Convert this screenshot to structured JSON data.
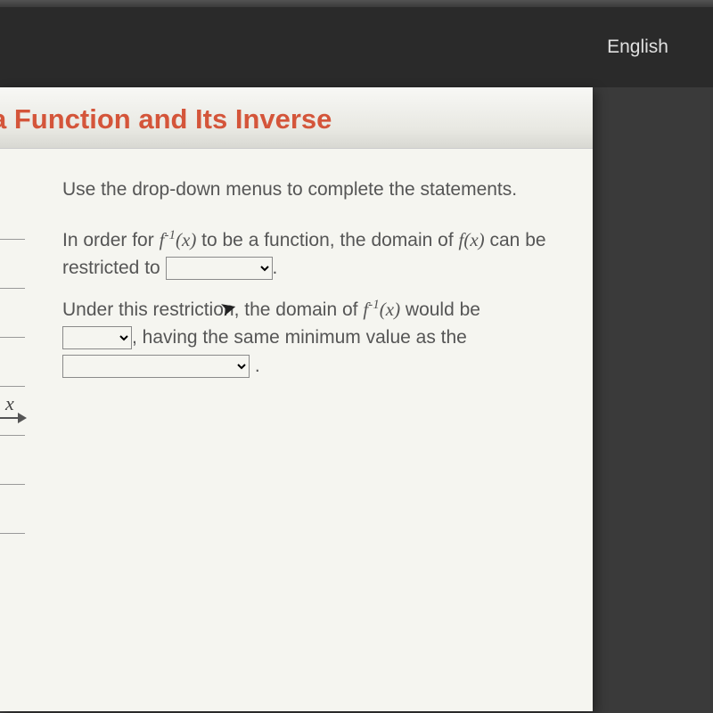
{
  "topbar": {
    "language": "English"
  },
  "header": {
    "title": "a Function and Its Inverse"
  },
  "content": {
    "instruction": "Use the drop-down menus to complete the statements.",
    "p1_prefix": "In order for ",
    "finv_html": "f",
    "finv_sup": "-1",
    "finv_x": "(x)",
    "p1_mid": " to be a function, the domain of ",
    "fx": "f(x)",
    "p1_suffix": " can be restricted to ",
    "p1_period": ".",
    "p2_prefix": "Under this restriction, the domain of ",
    "p2_mid": " would be ",
    "p2_suffix": ", having the same minimum value as the",
    "p2_period": " ."
  },
  "axis": {
    "x_label": "x"
  }
}
